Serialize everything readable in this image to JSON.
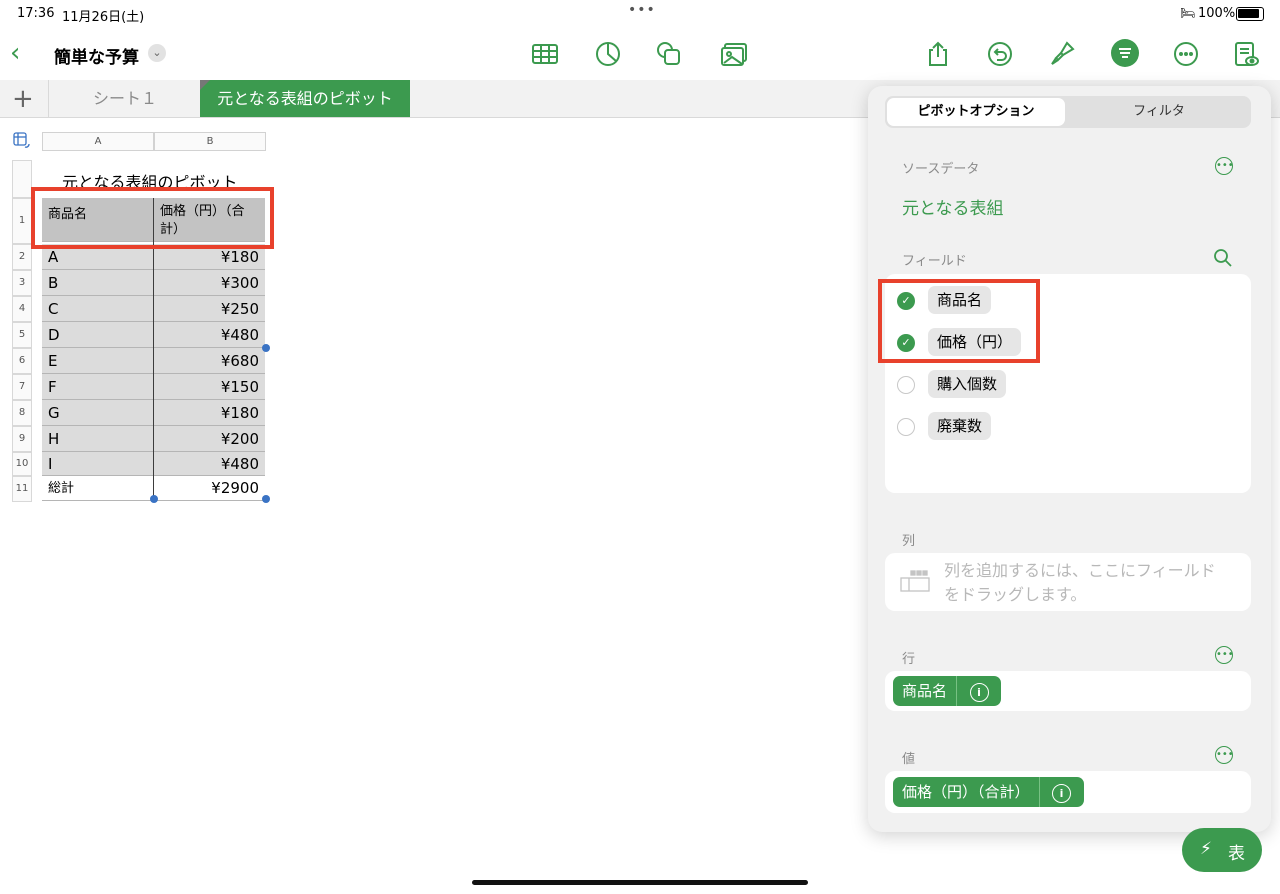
{
  "status": {
    "time": "17:36",
    "date": "11月26日(土)",
    "dots": "•••",
    "battery_pct": "100%"
  },
  "toolbar": {
    "doc_title": "簡単な予算",
    "chevron": "⌄",
    "back": "‹"
  },
  "tabs": {
    "add": "+",
    "sheet1": "シート１",
    "sheet2": "元となる表組のピボット"
  },
  "sheet": {
    "col_headers": [
      "A",
      "B"
    ],
    "table_title": "元となる表組のピボット",
    "header": {
      "a": "商品名",
      "b": "価格（円）（合計）"
    },
    "rows": [
      {
        "num": "1"
      },
      {
        "num": "2",
        "a": "A",
        "b": "¥180"
      },
      {
        "num": "3",
        "a": "B",
        "b": "¥300"
      },
      {
        "num": "4",
        "a": "C",
        "b": "¥250"
      },
      {
        "num": "5",
        "a": "D",
        "b": "¥480"
      },
      {
        "num": "6",
        "a": "E",
        "b": "¥680"
      },
      {
        "num": "7",
        "a": "F",
        "b": "¥150"
      },
      {
        "num": "8",
        "a": "G",
        "b": "¥180"
      },
      {
        "num": "9",
        "a": "H",
        "b": "¥200"
      },
      {
        "num": "10",
        "a": "I",
        "b": "¥480"
      },
      {
        "num": "11",
        "a": "総計",
        "b": "¥2900"
      }
    ]
  },
  "panel": {
    "seg_pivot": "ピボットオプション",
    "seg_filter": "フィルタ",
    "source_label": "ソースデータ",
    "source_value": "元となる表組",
    "fields_label": "フィールド",
    "fields": [
      {
        "name": "商品名",
        "checked": true
      },
      {
        "name": "価格（円）",
        "checked": true
      },
      {
        "name": "購入個数",
        "checked": false
      },
      {
        "name": "廃棄数",
        "checked": false
      }
    ],
    "columns_label": "列",
    "columns_placeholder_1": "列を追加するには、ここにフィールド",
    "columns_placeholder_2": "をドラッグします。",
    "rows_label": "行",
    "rows_pill": "商品名",
    "values_label": "値",
    "values_pill": "価格（円）（合計）",
    "info_glyph": "i",
    "more_glyph": "•••"
  },
  "quick": {
    "bolt": "⚡",
    "label": "表"
  },
  "colors": {
    "accent": "#3c9a4f",
    "highlight": "#e8412c",
    "selection": "#3a73c4"
  }
}
